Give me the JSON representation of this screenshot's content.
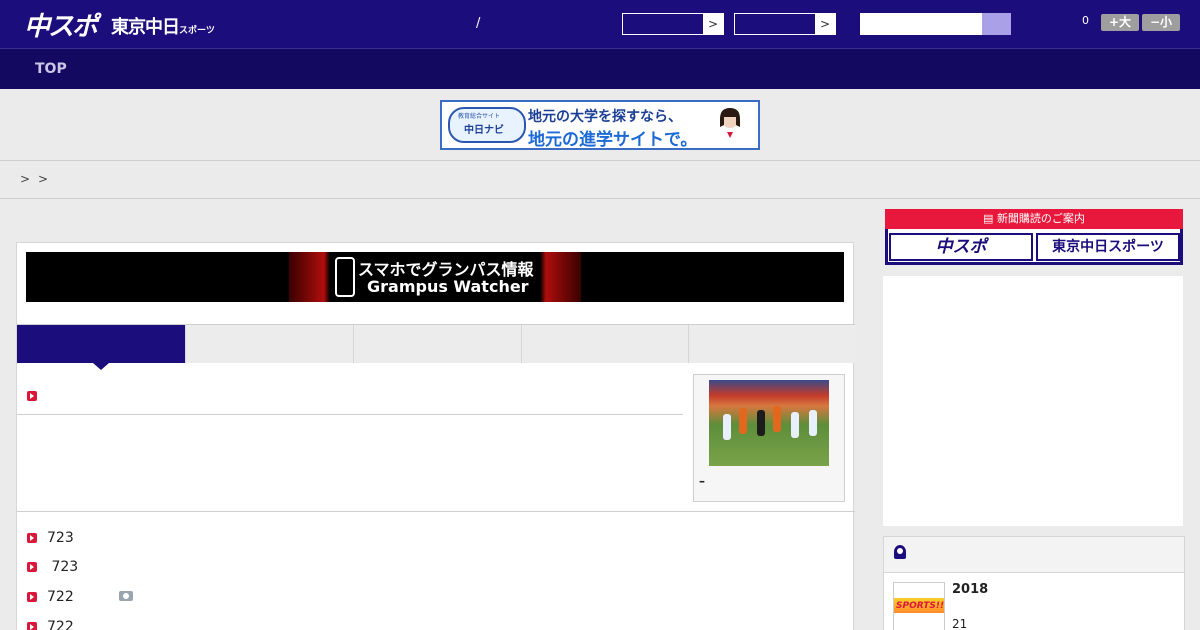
{
  "header": {
    "logo_chuspo": "中スポ",
    "logo_tokyo": "東京中日",
    "logo_tokyo_sub": "スポーツ",
    "separator": "/",
    "select_arrow": ">",
    "font_count": "0",
    "font_larger": "+大",
    "font_smaller": "−小"
  },
  "nav": {
    "top": "TOP"
  },
  "ad_banner": {
    "emblem_small": "教育総合サイト",
    "emblem_main": "中日ナビ",
    "line1": "地元の大学を探すなら、",
    "line2": "地元の進学サイトで。"
  },
  "breadcrumb": {
    "sep1": ">",
    "sep2": ">"
  },
  "grampus_banner": {
    "ja": "スマホでグランパス情報",
    "en": "Grampus Watcher"
  },
  "photo_caption": "–",
  "news_list": [
    {
      "num": "723",
      "has_camera": false
    },
    {
      "num": " 723",
      "has_camera": false
    },
    {
      "num": "722",
      "has_camera": true
    },
    {
      "num": "722",
      "has_camera": false
    }
  ],
  "subscription": {
    "head": "新聞購読のご案内",
    "btn1": "中スポ",
    "btn2": "東京中日スポーツ"
  },
  "ranking": {
    "year": "2018",
    "count": "21",
    "thumb_text": "SPORTS!!"
  },
  "colors": {
    "brand": "#1b0d7c",
    "accent_red": "#e8183c"
  }
}
